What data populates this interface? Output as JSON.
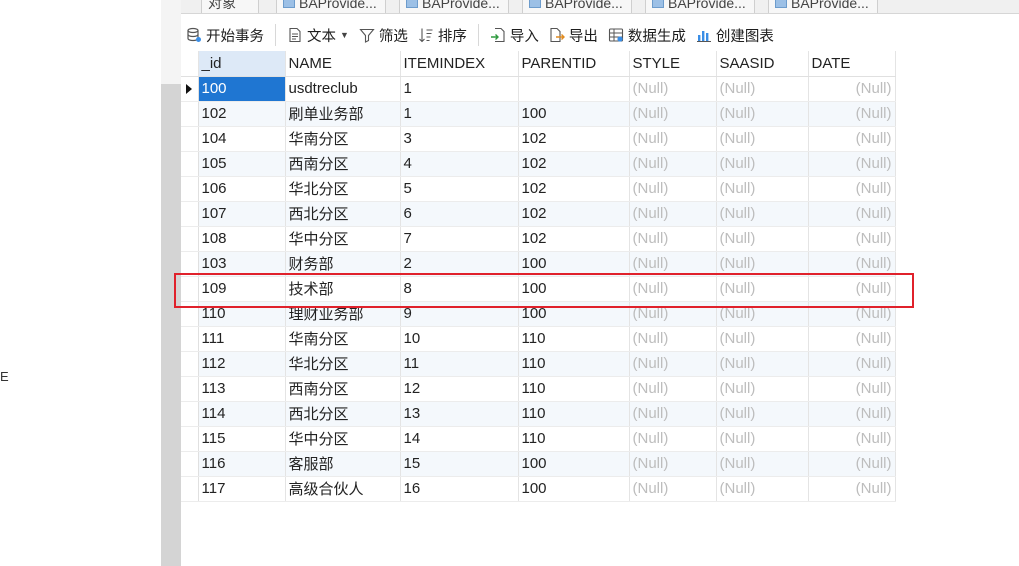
{
  "left_pane": {
    "partial_label": "E"
  },
  "tabs": [
    {
      "label": "对象"
    },
    {
      "label": "BAProvide..."
    },
    {
      "label": "BAProvide..."
    },
    {
      "label": "BAProvide..."
    },
    {
      "label": "BAProvide..."
    },
    {
      "label": "BAProvide..."
    }
  ],
  "toolbar": {
    "begin_transaction": "开始事务",
    "text": "文本",
    "filter": "筛选",
    "sort": "排序",
    "import": "导入",
    "export": "导出",
    "data_generate": "数据生成",
    "create_chart": "创建图表"
  },
  "table": {
    "columns": [
      "_id",
      "NAME",
      "ITEMINDEX",
      "PARENTID",
      "STYLE",
      "SAASID",
      "DATE"
    ],
    "null_text": "(Null)",
    "rows": [
      {
        "id": "100",
        "name": "usdtreclub",
        "itemindex": "1",
        "parentid": ""
      },
      {
        "id": "102",
        "name": "刷单业务部",
        "itemindex": "1",
        "parentid": "100"
      },
      {
        "id": "104",
        "name": "华南分区",
        "itemindex": "3",
        "parentid": "102"
      },
      {
        "id": "105",
        "name": "西南分区",
        "itemindex": "4",
        "parentid": "102"
      },
      {
        "id": "106",
        "name": "华北分区",
        "itemindex": "5",
        "parentid": "102"
      },
      {
        "id": "107",
        "name": "西北分区",
        "itemindex": "6",
        "parentid": "102"
      },
      {
        "id": "108",
        "name": "华中分区",
        "itemindex": "7",
        "parentid": "102"
      },
      {
        "id": "103",
        "name": "财务部",
        "itemindex": "2",
        "parentid": "100"
      },
      {
        "id": "109",
        "name": "技术部",
        "itemindex": "8",
        "parentid": "100"
      },
      {
        "id": "110",
        "name": "理财业务部",
        "itemindex": "9",
        "parentid": "100"
      },
      {
        "id": "111",
        "name": "华南分区",
        "itemindex": "10",
        "parentid": "110"
      },
      {
        "id": "112",
        "name": "华北分区",
        "itemindex": "11",
        "parentid": "110"
      },
      {
        "id": "113",
        "name": "西南分区",
        "itemindex": "12",
        "parentid": "110"
      },
      {
        "id": "114",
        "name": "西北分区",
        "itemindex": "13",
        "parentid": "110"
      },
      {
        "id": "115",
        "name": "华中分区",
        "itemindex": "14",
        "parentid": "110"
      },
      {
        "id": "116",
        "name": "客服部",
        "itemindex": "15",
        "parentid": "100"
      },
      {
        "id": "117",
        "name": "高级合伙人",
        "itemindex": "16",
        "parentid": "100"
      }
    ]
  },
  "colors": {
    "selection": "#1f76d2",
    "highlight_border": "#e0212b",
    "null_text": "#bdbdbd"
  }
}
